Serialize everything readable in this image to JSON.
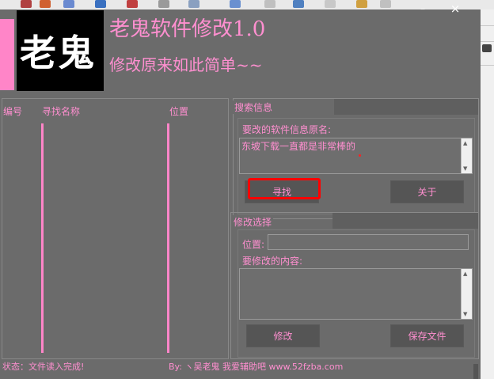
{
  "window": {
    "logo_text": "老鬼",
    "title": "老鬼软件修改1.0",
    "subtitle": "修改原来如此简单~~",
    "min_label": "–",
    "close_label": "×"
  },
  "list": {
    "columns": [
      "编号",
      "寻找名称",
      "位置"
    ]
  },
  "search_group": {
    "title": "搜索信息",
    "field_label": "要改的软件信息原名:",
    "field_value": "东坡下载一直都是非常棒的",
    "find_button": "寻找",
    "about_button": "关于"
  },
  "modify_group": {
    "title": "修改选择",
    "position_label": "位置:",
    "content_label": "要修改的内容:",
    "modify_button": "修改",
    "save_button": "保存文件"
  },
  "status": {
    "left": "状态：文件读入完成!",
    "right": "By: ヽ吴老鬼  我爱辅助吧 www.52fzba.com"
  },
  "colors": {
    "accent": "#ff8fd0",
    "pink_bar": "#ff85c8",
    "window_bg": "#6b6b6b",
    "highlight_red": "#ff0000"
  }
}
